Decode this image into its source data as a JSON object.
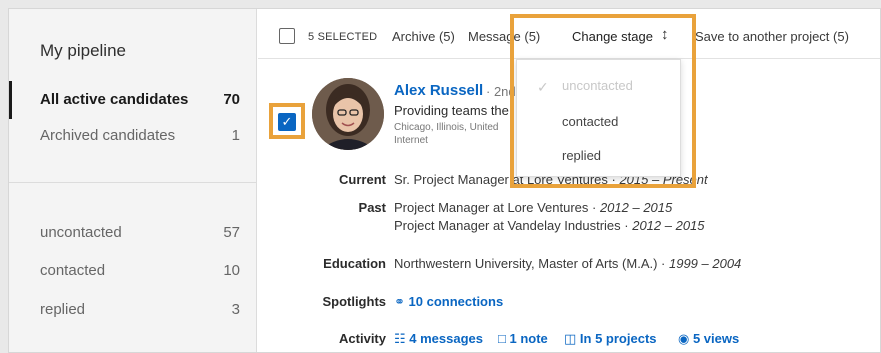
{
  "sidebar": {
    "title": "My pipeline",
    "items": [
      {
        "label": "All active candidates",
        "count": "70"
      },
      {
        "label": "Archived candidates",
        "count": "1"
      }
    ],
    "stages": [
      {
        "label": "uncontacted",
        "count": "57"
      },
      {
        "label": "contacted",
        "count": "10"
      },
      {
        "label": "replied",
        "count": "3"
      }
    ]
  },
  "toolbar": {
    "selected": "5 SELECTED",
    "archive": "Archive (5)",
    "message": "Message (5)",
    "change_stage": "Change stage",
    "change_stage_icon": "up-down-arrows-icon",
    "save": "Save to another project (5)"
  },
  "dropdown": {
    "options": [
      "uncontacted",
      "contacted",
      "replied"
    ],
    "selected": "uncontacted"
  },
  "candidate": {
    "name": "Alex Russell",
    "degree": "· 2nd",
    "headline": "Providing teams the",
    "location": "Chicago, Illinois, United",
    "industry": "Internet",
    "current_label": "Current",
    "current": "Sr. Project Manager at Lore Ventures · ",
    "current_dates": "2015 – Present",
    "past_label": "Past",
    "past": [
      {
        "text": "Project Manager at Lore Ventures · ",
        "dates": "2012 – 2015"
      },
      {
        "text": "Project Manager at Vandelay Industries · ",
        "dates": "2012 – 2015"
      }
    ],
    "education_label": "Education",
    "education": "Northwestern University, Master of Arts (M.A.) · ",
    "education_dates": "1999 – 2004",
    "spotlights_label": "Spotlights",
    "spotlights": "10 connections",
    "activity_label": "Activity",
    "activity": [
      "4 messages",
      "1 note",
      "In 5 projects",
      "5 views"
    ]
  },
  "colors": {
    "accent": "#0a66c2",
    "highlight": "#e9a23b"
  }
}
